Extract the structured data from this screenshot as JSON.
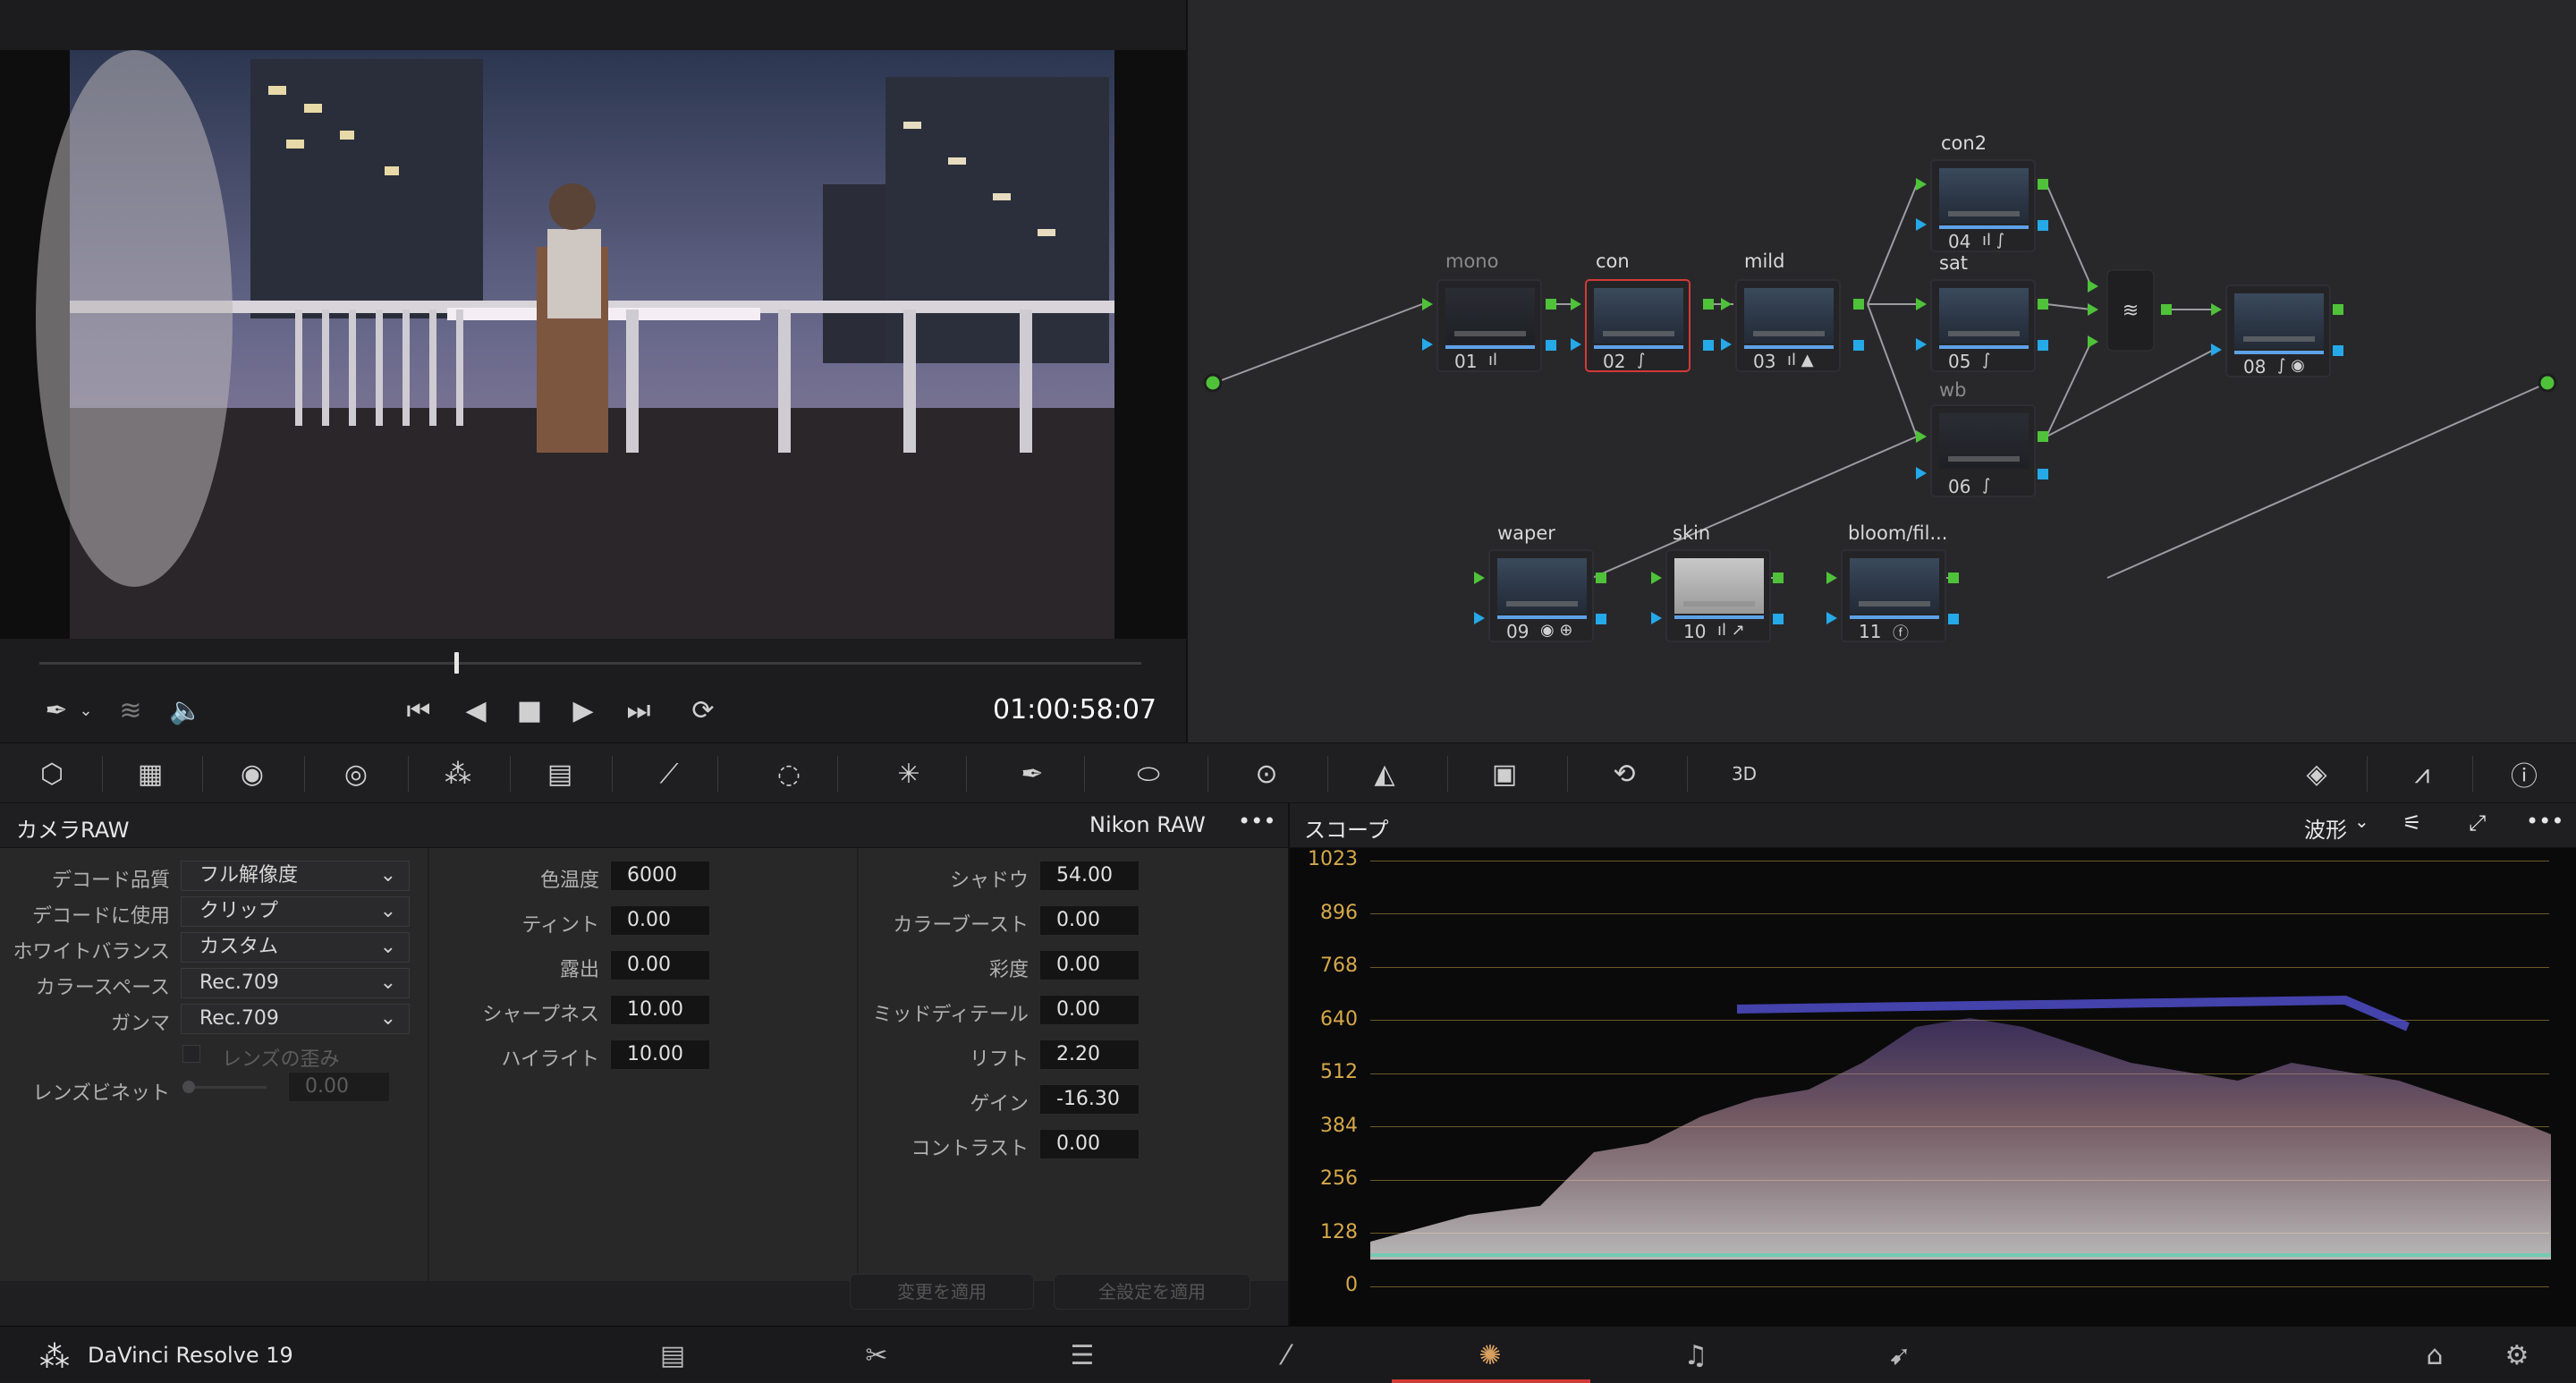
{
  "viewer": {
    "timecode": "01:00:58:07",
    "icons": [
      "picker-icon",
      "layers-icon",
      "volume-icon",
      "skip-back-icon",
      "prev-frame-icon",
      "stop-icon",
      "play-icon",
      "skip-forward-icon",
      "loop-icon"
    ]
  },
  "nodes": [
    {
      "label": "mono",
      "num": "01",
      "icons": "ıl",
      "dim": true
    },
    {
      "label": "con",
      "num": "02",
      "icons": "∫",
      "selected": true
    },
    {
      "label": "mild",
      "num": "03",
      "icons": "ıl ▲"
    },
    {
      "label": "con2",
      "num": "04",
      "icons": "ıl ∫"
    },
    {
      "label": "sat",
      "num": "05",
      "icons": "∫"
    },
    {
      "label": "wb",
      "num": "06",
      "icons": "∫",
      "dim": true
    },
    {
      "label": "",
      "num": "08",
      "icons": "∫ ◉"
    },
    {
      "label": "waper",
      "num": "09",
      "icons": "◉ ⊕"
    },
    {
      "label": "skin",
      "num": "10",
      "icons": "ıl ↗"
    },
    {
      "label": "bloom/fil...",
      "num": "11",
      "icons": "ⓕ"
    }
  ],
  "camera_raw": {
    "title": "カメラRAW",
    "format": "Nikon RAW",
    "more": "•••",
    "col1": {
      "decode_quality_label": "デコード品質",
      "decode_quality": "フル解像度",
      "decode_use_label": "デコードに使用",
      "decode_use": "クリップ",
      "white_balance_label": "ホワイトバランス",
      "white_balance": "カスタム",
      "color_space_label": "カラースペース",
      "color_space": "Rec.709",
      "gamma_label": "ガンマ",
      "gamma": "Rec.709",
      "lens_distortion_label": "レンズの歪み",
      "lens_vignette_label": "レンズビネット",
      "lens_vignette": "0.00"
    },
    "col2": {
      "color_temp_label": "色温度",
      "color_temp": "6000",
      "tint_label": "ティント",
      "tint": "0.00",
      "exposure_label": "露出",
      "exposure": "0.00",
      "sharpness_label": "シャープネス",
      "sharpness": "10.00",
      "highlight_label": "ハイライト",
      "highlight": "10.00"
    },
    "col3": {
      "shadow_label": "シャドウ",
      "shadow": "54.00",
      "color_boost_label": "カラーブースト",
      "color_boost": "0.00",
      "saturation_label": "彩度",
      "saturation": "0.00",
      "mid_detail_label": "ミッドディテール",
      "mid_detail": "0.00",
      "lift_label": "リフト",
      "lift": "2.20",
      "gain_label": "ゲイン",
      "gain": "-16.30",
      "contrast_label": "コントラスト",
      "contrast": "0.00"
    },
    "apply_changes": "変更を適用",
    "apply_all": "全設定を適用"
  },
  "scope": {
    "title": "スコープ",
    "mode": "波形",
    "more": "•••",
    "y_ticks": [
      "1023",
      "896",
      "768",
      "640",
      "512",
      "384",
      "256",
      "128",
      "0"
    ]
  },
  "footer": {
    "app_name": "DaVinci Resolve 19",
    "pages": [
      "media-page-icon",
      "cut-page-icon",
      "edit-page-icon",
      "fusion-page-icon",
      "color-page-icon",
      "fairlight-page-icon",
      "deliver-page-icon"
    ],
    "active_page": "color-page-icon"
  },
  "colors": {
    "accent_red": "#d23a36",
    "node_green": "#4fc23a",
    "node_blue": "#25a9e8",
    "scope_grid": "#d4a84a"
  }
}
